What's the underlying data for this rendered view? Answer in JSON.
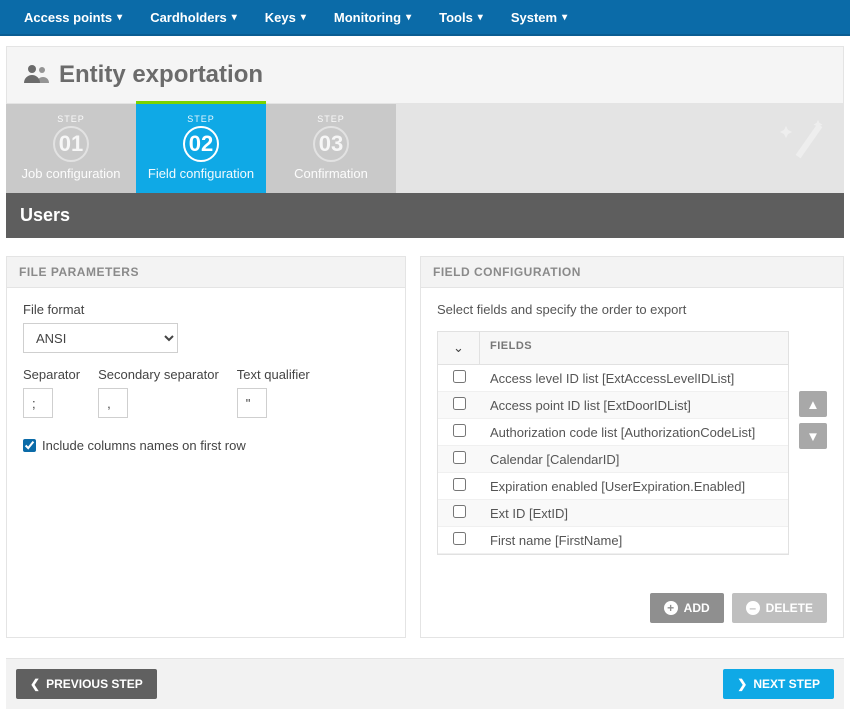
{
  "topnav": {
    "items": [
      {
        "label": "Access points"
      },
      {
        "label": "Cardholders"
      },
      {
        "label": "Keys"
      },
      {
        "label": "Monitoring"
      },
      {
        "label": "Tools"
      },
      {
        "label": "System"
      }
    ]
  },
  "page": {
    "title": "Entity exportation"
  },
  "steps": {
    "step_label": "STEP",
    "items": [
      {
        "num": "01",
        "title": "Job configuration",
        "active": false
      },
      {
        "num": "02",
        "title": "Field configuration",
        "active": true
      },
      {
        "num": "03",
        "title": "Confirmation",
        "active": false
      }
    ]
  },
  "sub_header": {
    "title": "Users"
  },
  "file_params": {
    "header": "FILE PARAMETERS",
    "file_format_label": "File format",
    "file_format_value": "ANSI",
    "separator_label": "Separator",
    "separator_value": ";",
    "secondary_separator_label": "Secondary separator",
    "secondary_separator_value": ",",
    "text_qualifier_label": "Text qualifier",
    "text_qualifier_value": "\"",
    "include_cols_label": "Include columns names on first row",
    "include_cols_checked": true
  },
  "field_config": {
    "header": "FIELD CONFIGURATION",
    "description": "Select fields and specify the order to export",
    "column_header": "FIELDS",
    "rows": [
      {
        "label": "Access level ID list [ExtAccessLevelIDList]"
      },
      {
        "label": "Access point ID list [ExtDoorIDList]"
      },
      {
        "label": "Authorization code list [AuthorizationCodeList]"
      },
      {
        "label": "Calendar [CalendarID]"
      },
      {
        "label": "Expiration enabled [UserExpiration.Enabled]"
      },
      {
        "label": "Ext ID [ExtID]"
      },
      {
        "label": "First name [FirstName]"
      }
    ],
    "add_label": "ADD",
    "delete_label": "DELETE"
  },
  "footer": {
    "prev_label": "PREVIOUS STEP",
    "next_label": "NEXT STEP"
  }
}
